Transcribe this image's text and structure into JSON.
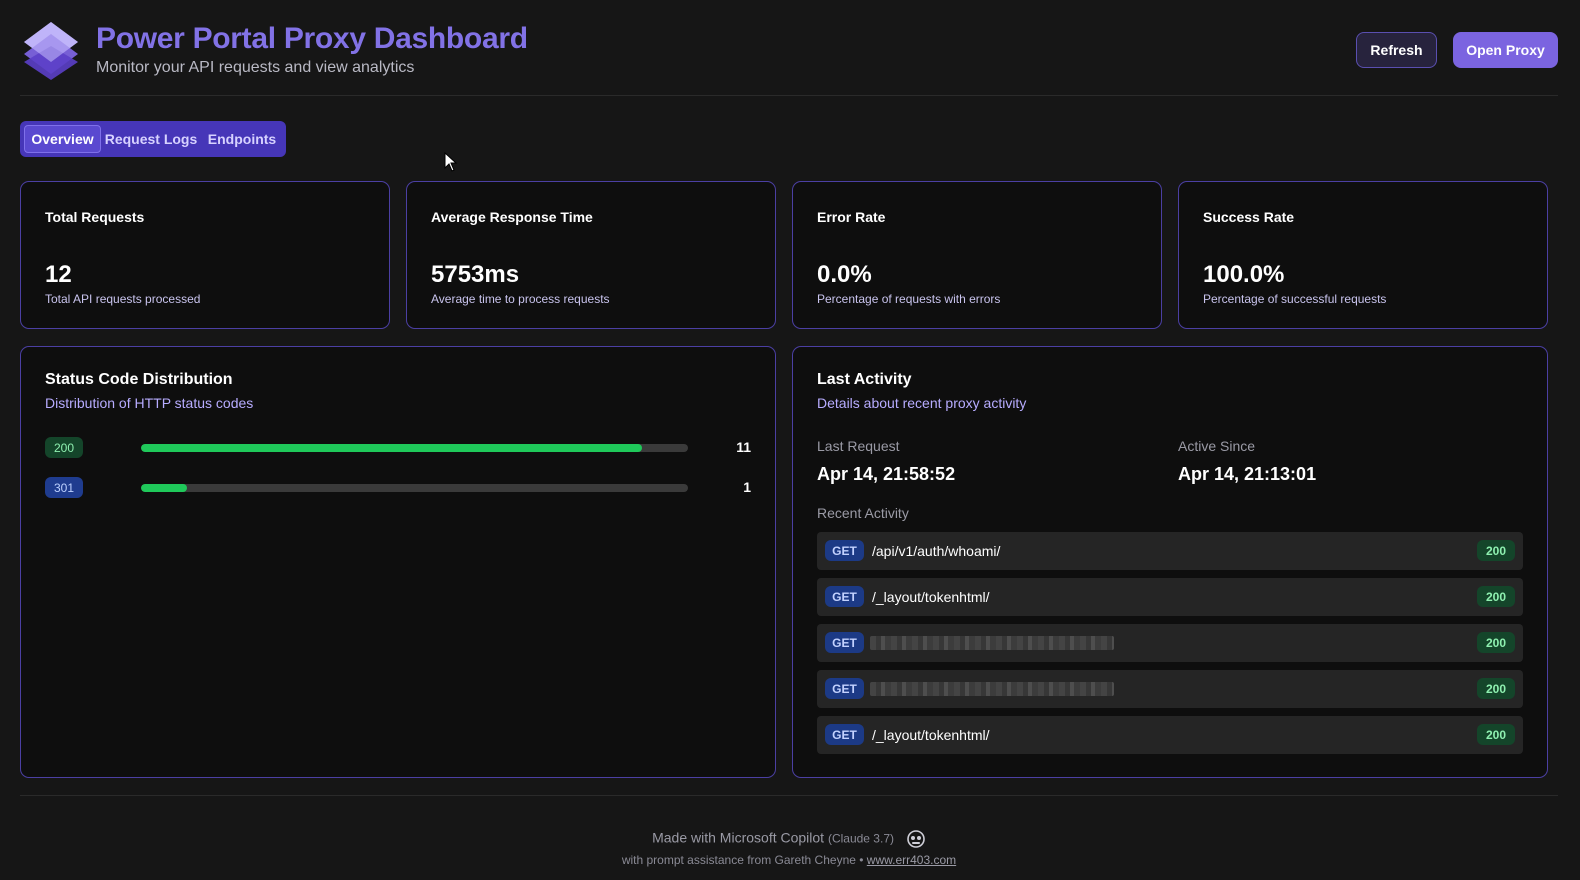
{
  "header": {
    "title": "Power Portal Proxy Dashboard",
    "subtitle": "Monitor your API requests and view analytics",
    "refresh_label": "Refresh",
    "open_proxy_label": "Open Proxy",
    "logo_icon": "layered-diamond-logo-icon"
  },
  "tabs": [
    {
      "label": "Overview",
      "active": true
    },
    {
      "label": "Request Logs",
      "active": false
    },
    {
      "label": "Endpoints",
      "active": false
    }
  ],
  "stats": [
    {
      "label": "Total Requests",
      "value": "12",
      "desc": "Total API requests processed"
    },
    {
      "label": "Average Response Time",
      "value": "5753ms",
      "desc": "Average time to process requests"
    },
    {
      "label": "Error Rate",
      "value": "0.0%",
      "desc": "Percentage of requests with errors"
    },
    {
      "label": "Success Rate",
      "value": "100.0%",
      "desc": "Percentage of successful requests"
    }
  ],
  "status_distribution": {
    "title": "Status Code Distribution",
    "desc": "Distribution of HTTP status codes",
    "rows": [
      {
        "code": "200",
        "count": "11",
        "fraction": 0.9167
      },
      {
        "code": "301",
        "count": "1",
        "fraction": 0.0833
      }
    ]
  },
  "last_activity": {
    "title": "Last Activity",
    "desc": "Details about recent proxy activity",
    "last_request_label": "Last Request",
    "last_request_value": "Apr 14, 21:58:52",
    "active_since_label": "Active Since",
    "active_since_value": "Apr 14, 21:13:01",
    "recent_label": "Recent Activity",
    "items": [
      {
        "method": "GET",
        "path": "/api/v1/auth/whoami/",
        "status": "200",
        "redacted": false
      },
      {
        "method": "GET",
        "path": "/_layout/tokenhtml/",
        "status": "200",
        "redacted": false
      },
      {
        "method": "GET",
        "path": "",
        "status": "200",
        "redacted": true
      },
      {
        "method": "GET",
        "path": "",
        "status": "200",
        "redacted": true
      },
      {
        "method": "GET",
        "path": "/_layout/tokenhtml/",
        "status": "200",
        "redacted": false
      }
    ]
  },
  "footer": {
    "made_with": "Made with Microsoft Copilot",
    "model": "(Claude 3.7)",
    "assist": "with prompt assistance from Gareth Cheyne •",
    "link": "www.err403.com"
  },
  "colors": {
    "accent": "#7b64e0",
    "bar_fill": "#1fc95a",
    "card_border": "#4b3fa3"
  }
}
